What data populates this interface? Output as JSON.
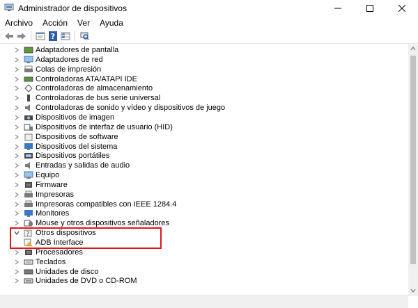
{
  "window": {
    "title": "Administrador de dispositivos",
    "controls": [
      "minimize",
      "maximize",
      "close"
    ]
  },
  "menu": [
    "Archivo",
    "Acción",
    "Ver",
    "Ayuda"
  ],
  "toolbar": [
    "back-arrow-icon",
    "forward-arrow-icon",
    "properties-icon",
    "help-icon",
    "view-icon",
    "scan-hardware-icon"
  ],
  "tree": [
    {
      "label": "Adaptadores de pantalla",
      "expanded": false,
      "icon": "display-adapter-icon"
    },
    {
      "label": "Adaptadores de red",
      "expanded": false,
      "icon": "network-adapter-icon"
    },
    {
      "label": "Colas de impresión",
      "expanded": false,
      "icon": "print-queue-icon"
    },
    {
      "label": "Controladoras ATA/ATAPI IDE",
      "expanded": false,
      "icon": "ide-controller-icon"
    },
    {
      "label": "Controladoras de almacenamiento",
      "expanded": false,
      "icon": "storage-controller-icon"
    },
    {
      "label": "Controladoras de bus serie universal",
      "expanded": false,
      "icon": "usb-controller-icon"
    },
    {
      "label": "Controladoras de sonido y vídeo y dispositivos de juego",
      "expanded": false,
      "icon": "sound-icon"
    },
    {
      "label": "Dispositivos de imagen",
      "expanded": false,
      "icon": "camera-icon"
    },
    {
      "label": "Dispositivos de interfaz de usuario (HID)",
      "expanded": false,
      "icon": "hid-icon"
    },
    {
      "label": "Dispositivos de software",
      "expanded": false,
      "icon": "software-device-icon"
    },
    {
      "label": "Dispositivos del sistema",
      "expanded": false,
      "icon": "system-device-icon"
    },
    {
      "label": "Dispositivos portátiles",
      "expanded": false,
      "icon": "portable-device-icon"
    },
    {
      "label": "Entradas y salidas de audio",
      "expanded": false,
      "icon": "audio-io-icon"
    },
    {
      "label": "Equipo",
      "expanded": false,
      "icon": "computer-icon"
    },
    {
      "label": "Firmware",
      "expanded": false,
      "icon": "firmware-icon"
    },
    {
      "label": "Impresoras",
      "expanded": false,
      "icon": "printer-icon"
    },
    {
      "label": "Impresoras compatibles con IEEE 1284.4",
      "expanded": false,
      "icon": "printer-icon"
    },
    {
      "label": "Monitores",
      "expanded": false,
      "icon": "monitor-icon"
    },
    {
      "label": "Mouse y otros dispositivos señaladores",
      "expanded": false,
      "icon": "mouse-icon"
    },
    {
      "label": "Otros dispositivos",
      "expanded": true,
      "icon": "unknown-device-icon",
      "children": [
        {
          "label": "ADB Interface",
          "icon": "warning-device-icon"
        }
      ]
    },
    {
      "label": "Procesadores",
      "expanded": false,
      "icon": "processor-icon"
    },
    {
      "label": "Teclados",
      "expanded": false,
      "icon": "keyboard-icon"
    },
    {
      "label": "Unidades de disco",
      "expanded": false,
      "icon": "disk-drive-icon"
    },
    {
      "label": "Unidades de DVD o CD-ROM",
      "expanded": false,
      "icon": "dvd-drive-icon"
    }
  ],
  "colors": {
    "highlight_box": "#e0151c"
  }
}
